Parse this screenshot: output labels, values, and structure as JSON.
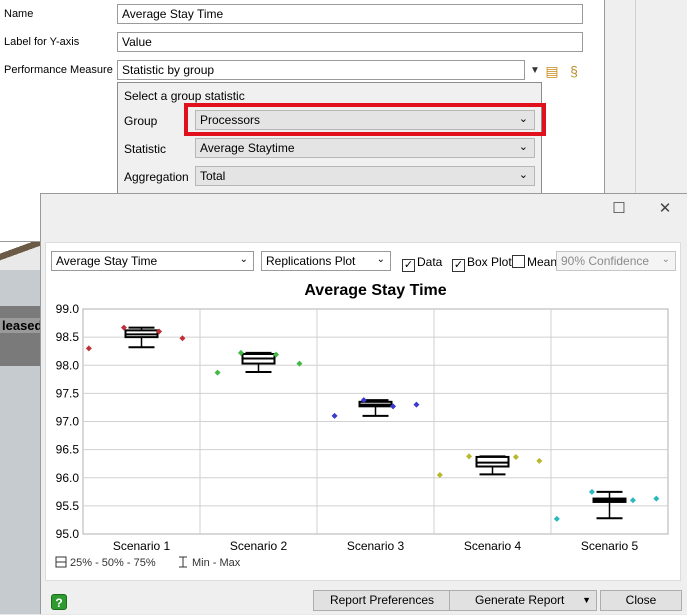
{
  "properties": {
    "name_label": "Name",
    "name_value": "Average Stay Time",
    "ylabel_label": "Label for Y-axis",
    "ylabel_value": "Value",
    "measure_label": "Performance Measure",
    "measure_value": "Statistic by group"
  },
  "group_popup": {
    "title": "Select a group statistic",
    "group_label": "Group",
    "group_value": "Processors",
    "statistic_label": "Statistic",
    "statistic_value": "Average Staytime",
    "aggregation_label": "Aggregation",
    "aggregation_value": "Total"
  },
  "background": {
    "partial_text": "leased"
  },
  "chart_window": {
    "toolbar": {
      "measure_select": "Average Stay Time",
      "plot_type_select": "Replications Plot",
      "data_label": "Data",
      "data_checked": true,
      "boxplot_label": "Box Plot",
      "boxplot_checked": true,
      "mean_label": "Mean",
      "mean_checked": false,
      "confidence_select": "90% Confidence"
    },
    "legend": {
      "box_label": "25% - 50% - 75%",
      "whisker_label": "Min - Max"
    },
    "buttons": {
      "report_prefs": "Report Preferences",
      "generate_report": "Generate Report",
      "close": "Close"
    },
    "help_icon": "?"
  },
  "chart_data": {
    "type": "scatter",
    "title": "Average Stay Time",
    "xlabel": "",
    "ylabel": "",
    "categories": [
      "Scenario 1",
      "Scenario 2",
      "Scenario 3",
      "Scenario 4",
      "Scenario 5"
    ],
    "ylim": [
      95.0,
      99.0
    ],
    "yticks": [
      "99.0",
      "98.5",
      "98.0",
      "97.5",
      "97.0",
      "96.5",
      "96.0",
      "95.5",
      "95.0"
    ],
    "grid": true,
    "series": [
      {
        "color": "#c0303a",
        "points": [
          [
            -0.45,
            98.3
          ],
          [
            -0.15,
            98.67
          ],
          [
            0.15,
            98.6
          ],
          [
            0.35,
            98.48
          ]
        ],
        "box": {
          "min": 98.32,
          "q1": 98.5,
          "median": 98.55,
          "q3": 98.62,
          "max": 98.67
        }
      },
      {
        "color": "#44b844",
        "points": [
          [
            -0.35,
            97.87
          ],
          [
            -0.15,
            98.22
          ],
          [
            0.15,
            98.19
          ],
          [
            0.35,
            98.03
          ]
        ],
        "box": {
          "min": 97.88,
          "q1": 98.03,
          "median": 98.12,
          "q3": 98.2,
          "max": 98.22
        }
      },
      {
        "color": "#3a3ad0",
        "points": [
          [
            -0.35,
            97.1
          ],
          [
            -0.1,
            97.38
          ],
          [
            0.15,
            97.27
          ],
          [
            0.35,
            97.3
          ]
        ],
        "box": {
          "min": 97.1,
          "q1": 97.27,
          "median": 97.3,
          "q3": 97.35,
          "max": 97.38
        }
      },
      {
        "color": "#b8b82a",
        "points": [
          [
            -0.45,
            96.05
          ],
          [
            -0.2,
            96.38
          ],
          [
            0.2,
            96.37
          ],
          [
            0.4,
            96.3
          ]
        ],
        "box": {
          "min": 96.06,
          "q1": 96.2,
          "median": 96.27,
          "q3": 96.37,
          "max": 96.38
        }
      },
      {
        "color": "#2ab8c0",
        "points": [
          [
            -0.45,
            95.27
          ],
          [
            -0.15,
            95.75
          ],
          [
            0.2,
            95.6
          ],
          [
            0.4,
            95.63
          ]
        ],
        "box": {
          "min": 95.28,
          "q1": 95.57,
          "median": 95.6,
          "q3": 95.63,
          "max": 95.75
        }
      }
    ]
  }
}
